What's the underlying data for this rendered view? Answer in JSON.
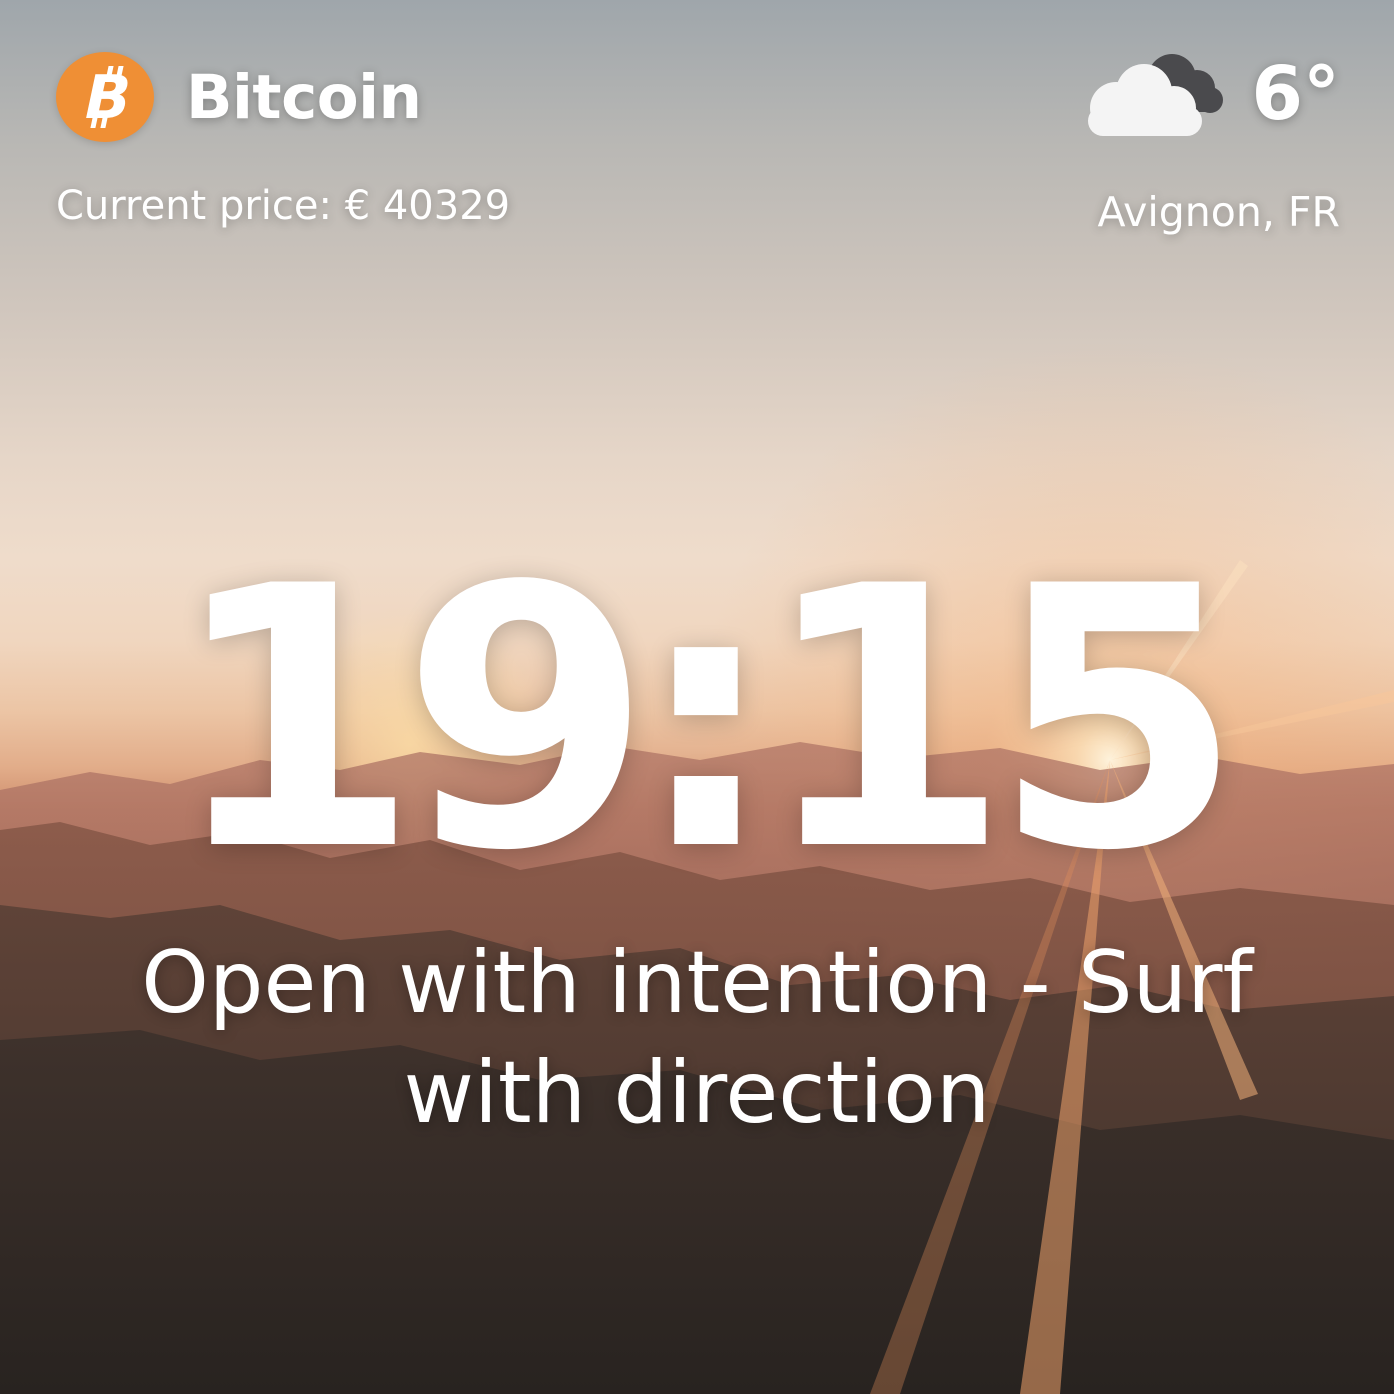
{
  "bitcoin": {
    "title": "Bitcoin",
    "logo_icon": "bitcoin-icon",
    "logo_color": "#ef8f35",
    "price_text": "Current price: € 40329"
  },
  "weather": {
    "icon": "cloudy-icon",
    "temperature": "6°",
    "location": "Avignon, FR"
  },
  "clock": {
    "time": "19:15"
  },
  "quote": {
    "line1": "Open with intention - Surf",
    "line2": "with direction"
  }
}
